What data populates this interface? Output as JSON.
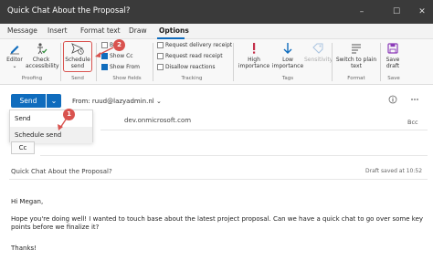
{
  "window": {
    "title": "Quick Chat About the Proposal?",
    "controls": {
      "minimize": "–",
      "maximize": "☐",
      "close": "✕"
    }
  },
  "tabs": [
    "Message",
    "Insert",
    "Format text",
    "Draw",
    "Options"
  ],
  "active_tab": "Options",
  "ribbon": {
    "groups": {
      "proofing": {
        "label": "Proofing",
        "buttons": [
          {
            "label": "Editor",
            "chevron": "⌄"
          },
          {
            "label": "Check accessibility"
          }
        ]
      },
      "send": {
        "label": "Send",
        "buttons": [
          {
            "label": "Schedule send"
          }
        ]
      },
      "show_fields": {
        "label": "Show fields",
        "checkboxes": [
          {
            "label": "Bcc",
            "checked": false
          },
          {
            "label": "Show Cc",
            "checked": true
          },
          {
            "label": "Show From",
            "checked": true
          }
        ]
      },
      "tracking": {
        "label": "Tracking",
        "checkboxes": [
          {
            "label": "Request delivery receipt",
            "checked": false
          },
          {
            "label": "Request read receipt",
            "checked": false
          },
          {
            "label": "Disallow reactions",
            "checked": false
          }
        ]
      },
      "tags": {
        "label": "Tags",
        "buttons": [
          {
            "label": "High importance"
          },
          {
            "label": "Low importance"
          },
          {
            "label": "Sensitivity"
          }
        ]
      },
      "format": {
        "label": "Format",
        "buttons": [
          {
            "label": "Switch to plain text"
          }
        ]
      },
      "save": {
        "label": "Save",
        "buttons": [
          {
            "label": "Save draft"
          }
        ]
      }
    }
  },
  "compose": {
    "send_label": "Send",
    "send_dropdown": "⌄",
    "from_label": "From: ruud@lazyadmin.nl",
    "from_chevron": "⌄",
    "dropdown_items": [
      "Send",
      "Schedule send"
    ],
    "to_value": "dev.onmicrosoft.com",
    "bcc_label": "Bcc",
    "cc_label": "Cc",
    "subject": "Quick Chat About the Proposal?",
    "draft_status": "Draft saved at 10:52",
    "body_lines": [
      "Hi Megan,",
      "Hope you're doing well! I wanted to touch base about the latest project proposal. Can we have a quick chat to go over some key points before we finalize it?",
      "Thanks!"
    ]
  },
  "callouts": [
    "1",
    "2"
  ],
  "colors": {
    "accent": "#0f6cbd",
    "titlebar": "#3a3a3a",
    "callout": "#d9534f",
    "high_importance": "#c4314b",
    "low_importance": "#0f6cbd",
    "save_icon": "#8b3ab8"
  }
}
